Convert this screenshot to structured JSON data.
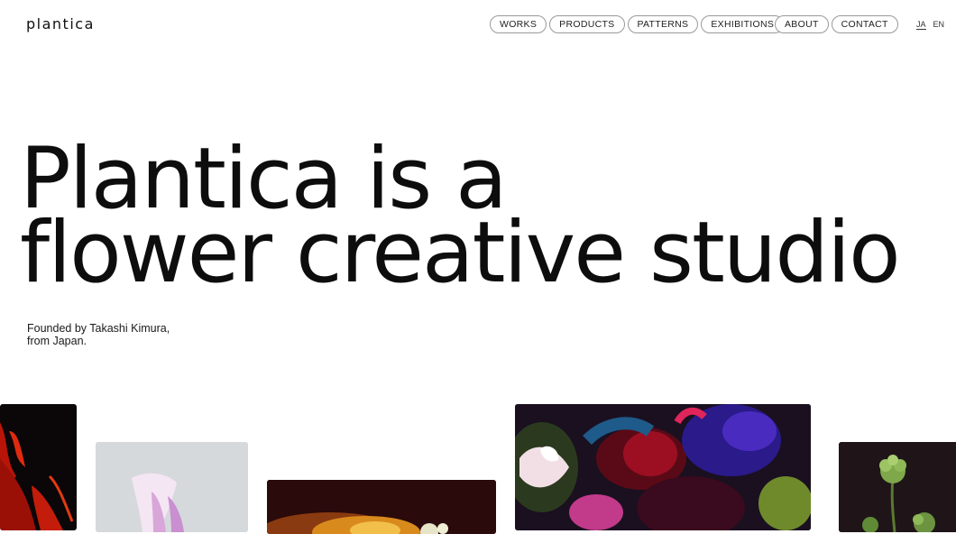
{
  "header": {
    "logo": "plantica",
    "nav_main": [
      "WORKS",
      "PRODUCTS",
      "PATTERNS",
      "EXHIBITIONS"
    ],
    "nav_secondary": [
      "ABOUT",
      "CONTACT"
    ],
    "languages": [
      "JA",
      "EN"
    ],
    "active_language": "JA"
  },
  "hero": {
    "line1": "Plantica is a",
    "line2": "flower creative studio"
  },
  "tagline": {
    "line1": "Founded by Takashi Kimura,",
    "line2": "from Japan."
  },
  "gallery": {
    "tiles": [
      {
        "subject": "red-lily-flower",
        "accent": "#d4200c"
      },
      {
        "subject": "pale-pink-flower",
        "accent": "#e9c8ea"
      },
      {
        "subject": "warm-lit-arrangement",
        "accent": "#e0a020"
      },
      {
        "subject": "dark-floral-bouquet",
        "accent": "#4a2bbf"
      },
      {
        "subject": "green-buds",
        "accent": "#7ea84a"
      }
    ]
  }
}
